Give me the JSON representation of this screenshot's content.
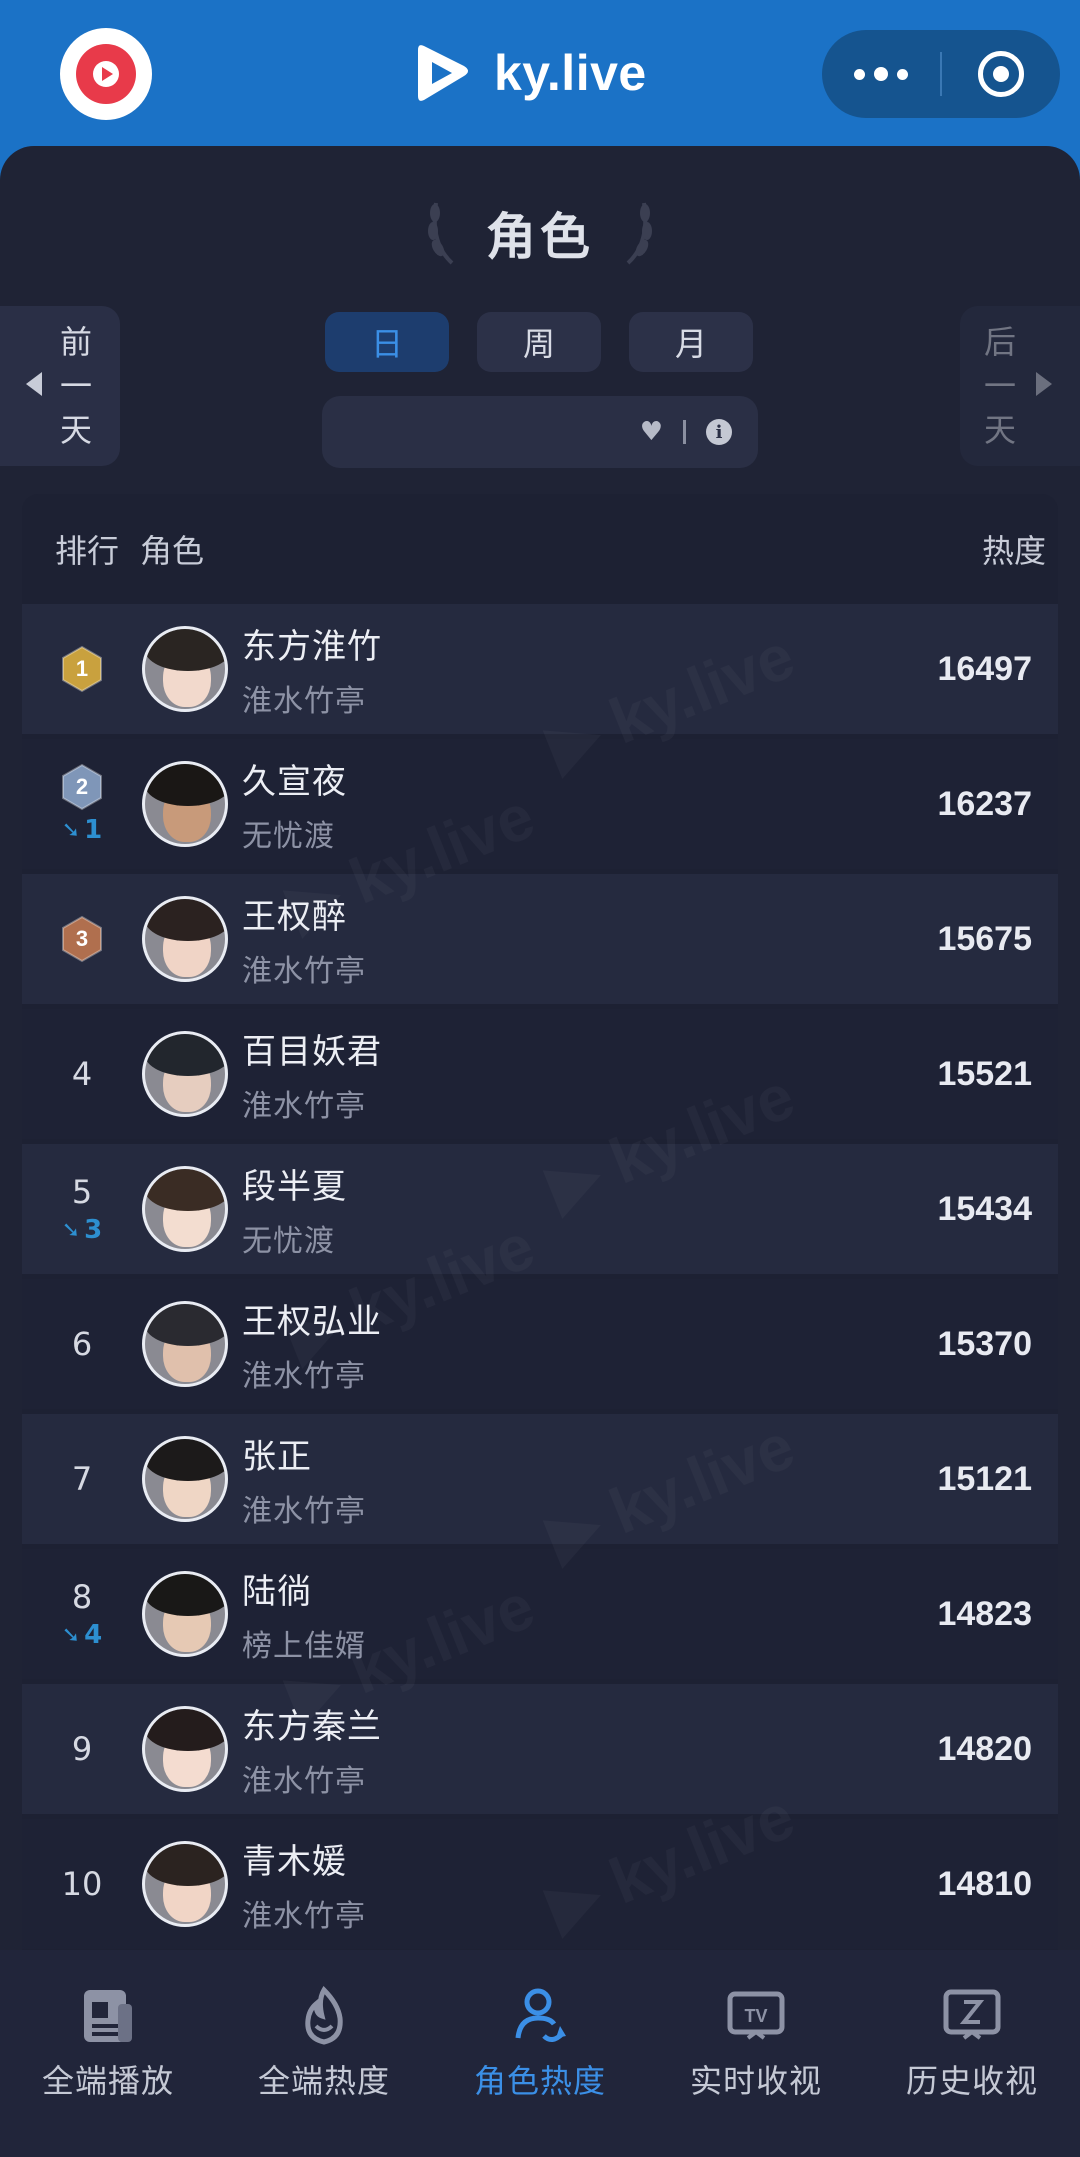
{
  "brand": {
    "name": "ky.live"
  },
  "page": {
    "title": "角色"
  },
  "day_nav": {
    "prev_label": "前一天",
    "next_label": "后一天"
  },
  "periods": [
    {
      "label": "日",
      "active": true
    },
    {
      "label": "周",
      "active": false
    },
    {
      "label": "月",
      "active": false
    }
  ],
  "date_select": {
    "value": ""
  },
  "table": {
    "headers": {
      "rank": "排行",
      "role": "角色",
      "heat": "热度"
    },
    "rows": [
      {
        "rank": "1",
        "badge": "gold",
        "change": "",
        "name": "东方淮竹",
        "show": "淮水竹亭",
        "heat": "16497"
      },
      {
        "rank": "2",
        "badge": "silver",
        "change": "1",
        "name": "久宣夜",
        "show": "无忧渡",
        "heat": "16237"
      },
      {
        "rank": "3",
        "badge": "bronze",
        "change": "",
        "name": "王权醉",
        "show": "淮水竹亭",
        "heat": "15675"
      },
      {
        "rank": "4",
        "badge": "",
        "change": "",
        "name": "百目妖君",
        "show": "淮水竹亭",
        "heat": "15521"
      },
      {
        "rank": "5",
        "badge": "",
        "change": "3",
        "name": "段半夏",
        "show": "无忧渡",
        "heat": "15434"
      },
      {
        "rank": "6",
        "badge": "",
        "change": "",
        "name": "王权弘业",
        "show": "淮水竹亭",
        "heat": "15370"
      },
      {
        "rank": "7",
        "badge": "",
        "change": "",
        "name": "张正",
        "show": "淮水竹亭",
        "heat": "15121"
      },
      {
        "rank": "8",
        "badge": "",
        "change": "4",
        "name": "陆徜",
        "show": "榜上佳婿",
        "heat": "14823"
      },
      {
        "rank": "9",
        "badge": "",
        "change": "",
        "name": "东方秦兰",
        "show": "淮水竹亭",
        "heat": "14820"
      },
      {
        "rank": "10",
        "badge": "",
        "change": "",
        "name": "青木媛",
        "show": "淮水竹亭",
        "heat": "14810"
      }
    ]
  },
  "tabs": [
    {
      "label": "全端播放",
      "icon": "document-icon",
      "active": false
    },
    {
      "label": "全端热度",
      "icon": "flame-icon",
      "active": false
    },
    {
      "label": "角色热度",
      "icon": "user-refresh-icon",
      "active": true
    },
    {
      "label": "实时收视",
      "icon": "tv-icon",
      "active": false
    },
    {
      "label": "历史收视",
      "icon": "history-tv-icon",
      "active": false
    }
  ],
  "colors": {
    "header_blue": "#1b72c6",
    "panel_bg": "#1f2335",
    "accent_blue": "#3b8fe6",
    "change_blue": "#2d8fd0",
    "gold": "#c9a13e",
    "silver": "#7f96b8",
    "bronze": "#b06f4e"
  }
}
